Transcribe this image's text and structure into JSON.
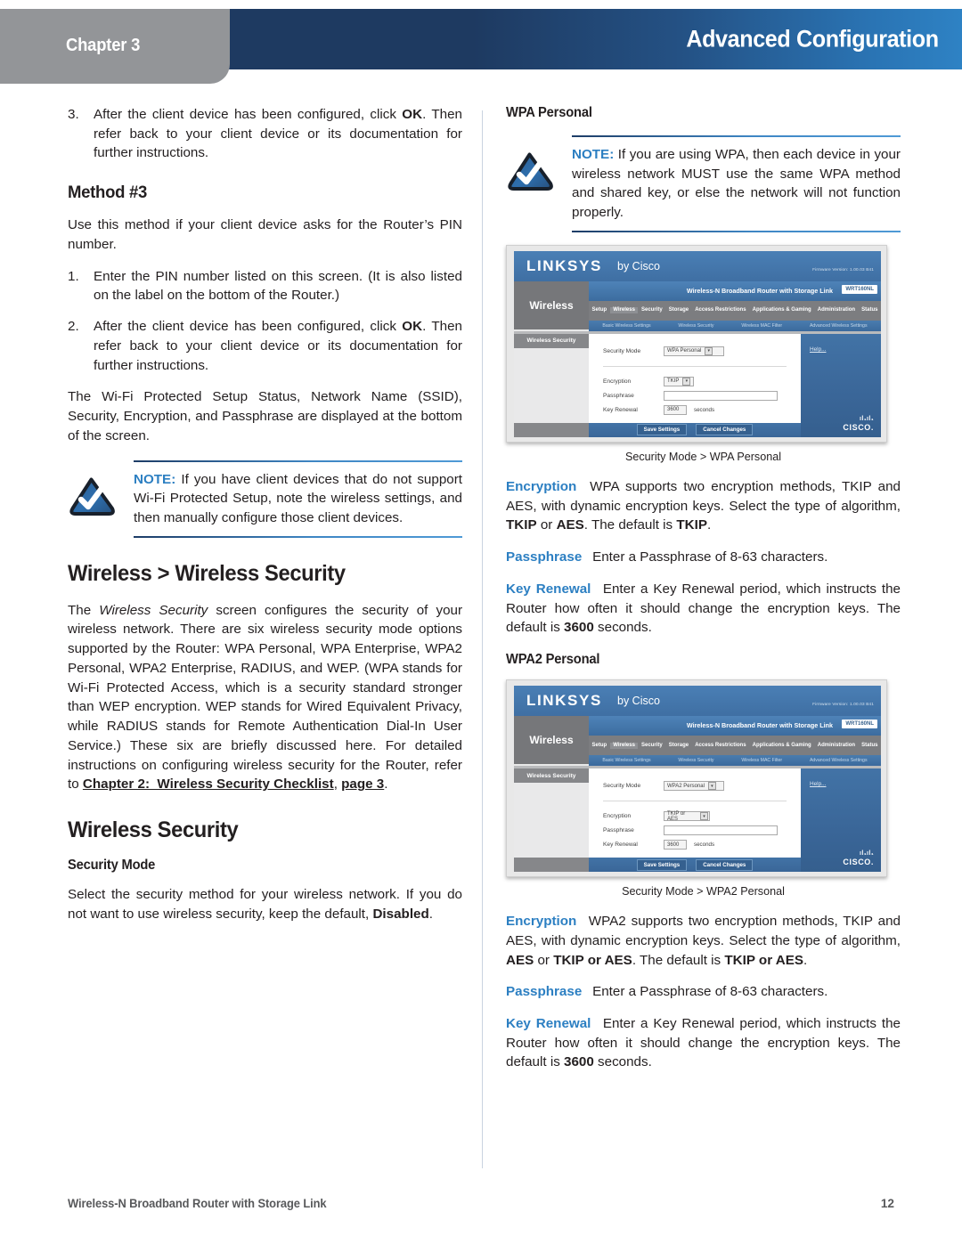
{
  "header": {
    "chapter_label": "Chapter 3",
    "title": "Advanced Configuration",
    "gradient_start": "#1e3a61",
    "gradient_end": "#2e82c4",
    "tab_bg": "#939598"
  },
  "left_column": {
    "list_a": [
      {
        "num": "3.",
        "html": "After the client device has been configured, click <b>OK</b>. Then refer back to your client device or its documentation for further instructions."
      }
    ],
    "heading_method3": "Method #3",
    "para_method3": "Use this method if your client device asks for the Router’s PIN number.",
    "list_b": [
      {
        "num": "1.",
        "html": "Enter the PIN number listed on this screen. (It is also listed on the label on the bottom of the Router.)"
      },
      {
        "num": "2.",
        "html": "After the client device has been configured, click <b>OK</b>. Then refer back to your client device or its documentation for further instructions."
      }
    ],
    "para_status": "The Wi-Fi Protected Setup Status, Network Name (SSID), Security, Encryption, and Passphrase are displayed at the bottom of the screen.",
    "note": {
      "label": "NOTE:",
      "text": "If you have client devices that do not support Wi-Fi Protected Setup, note the wireless settings, and then manually configure those client devices."
    },
    "heading_wireless_security": "Wireless > Wireless Security",
    "para_wireless_security": "The <i>Wireless Security</i> screen configures the security of your wireless network. There are six wireless security mode options supported by the Router: WPA Personal, WPA Enterprise, WPA2 Personal, WPA2 Enterprise, RADIUS, and WEP. (WPA stands for Wi-Fi Protected Access, which is a security standard stronger than WEP encryption. WEP stands for Wired Equivalent Privacy, while RADIUS stands for Remote Authentication Dial-In User Service.) These six are briefly discussed here. For detailed instructions on configuring wireless security for the Router, refer to <span class=\"xref\">Chapter 2:&nbsp; Wireless Security Checklist</span>, <span class=\"xref\">page 3</span>.",
    "heading_wireless_security_sub": "Wireless Security",
    "heading_security_mode": "Security Mode",
    "para_security_mode": "Select the security method for your wireless network. If you do not want to use wireless security, keep the default, <b>Disabled</b>."
  },
  "right_column": {
    "heading_wpa_personal": "WPA Personal",
    "note": {
      "label": "NOTE:",
      "text": "If you are using WPA, then each device in your wireless network MUST use the same WPA method and shared key, or else the network will not function properly."
    },
    "figure_wpa": {
      "caption": "Security Mode > WPA Personal",
      "logo": "LINKSYS",
      "logo_suffix": "by Cisco",
      "firmware_version": "Firmware Version: 1.00.03 B41",
      "model_text": "Wireless-N Broadband Router with Storage Link",
      "model_badge": "WRT160NL",
      "side_label": "Wireless",
      "tabs": [
        "Setup",
        "Wireless",
        "Security",
        "Storage",
        "Access Restrictions",
        "Applications & Gaming",
        "Administration",
        "Status"
      ],
      "active_tab": "Wireless",
      "subtabs": [
        "Basic Wireless Settings",
        "Wireless Security",
        "Wireless MAC Filter",
        "Advanced Wireless Settings"
      ],
      "panel_title": "Wireless Security",
      "fields": [
        {
          "label": "Security Mode",
          "type": "select",
          "value": "WPA Personal"
        },
        {
          "label": "Encryption",
          "type": "select",
          "value": "TKIP"
        },
        {
          "label": "Passphrase",
          "type": "text",
          "value": ""
        },
        {
          "label": "Key Renewal",
          "type": "text-unit",
          "value": "3600",
          "unit": "seconds"
        }
      ],
      "help_link": "Help...",
      "buttons": [
        "Save Settings",
        "Cancel Changes"
      ],
      "cisco_brand": "CISCO."
    },
    "para_encryption_wpa": "<span class=\"kw\">Encryption</span>  WPA supports two encryption methods, TKIP and AES, with dynamic encryption keys. Select the type of algorithm, <b>TKIP</b> or <b>AES</b>. The default is <b>TKIP</b>.",
    "para_passphrase_wpa": "<span class=\"kw\">Passphrase</span>  Enter a Passphrase of 8-63 characters.",
    "para_keyrenewal_wpa": "<span class=\"kw\">Key Renewal</span>  Enter a Key Renewal period, which instructs the Router how often it should change the encryption keys. The default is <b>3600</b> seconds.",
    "heading_wpa2_personal": "WPA2 Personal",
    "figure_wpa2": {
      "caption": "Security Mode > WPA2 Personal",
      "logo": "LINKSYS",
      "logo_suffix": "by Cisco",
      "firmware_version": "Firmware Version: 1.00.03 B41",
      "model_text": "Wireless-N Broadband Router with Storage Link",
      "model_badge": "WRT160NL",
      "side_label": "Wireless",
      "tabs": [
        "Setup",
        "Wireless",
        "Security",
        "Storage",
        "Access Restrictions",
        "Applications & Gaming",
        "Administration",
        "Status"
      ],
      "active_tab": "Wireless",
      "subtabs": [
        "Basic Wireless Settings",
        "Wireless Security",
        "Wireless MAC Filter",
        "Advanced Wireless Settings"
      ],
      "panel_title": "Wireless Security",
      "fields": [
        {
          "label": "Security Mode",
          "type": "select",
          "value": "WPA2 Personal"
        },
        {
          "label": "Encryption",
          "type": "select",
          "value": "TKIP or AES"
        },
        {
          "label": "Passphrase",
          "type": "text",
          "value": ""
        },
        {
          "label": "Key Renewal",
          "type": "text-unit",
          "value": "3600",
          "unit": "seconds"
        }
      ],
      "help_link": "Help...",
      "buttons": [
        "Save Settings",
        "Cancel Changes"
      ],
      "cisco_brand": "CISCO."
    },
    "para_encryption_wpa2": "<span class=\"kw\">Encryption</span>  WPA2 supports two encryption methods, TKIP and AES, with dynamic encryption keys. Select the type of algorithm, <b>AES</b> or <b>TKIP or AES</b>. The default is <b>TKIP or AES</b>.",
    "para_passphrase_wpa2": "<span class=\"kw\">Passphrase</span>  Enter a Passphrase of 8-63 characters.",
    "para_keyrenewal_wpa2": "<span class=\"kw\">Key Renewal</span>  Enter a Key Renewal period, which instructs the Router how often it should change the encryption keys. The default is <b>3600</b> seconds."
  },
  "footer": {
    "left": "Wireless-N Broadband Router with Storage Link",
    "page_number": "12"
  }
}
